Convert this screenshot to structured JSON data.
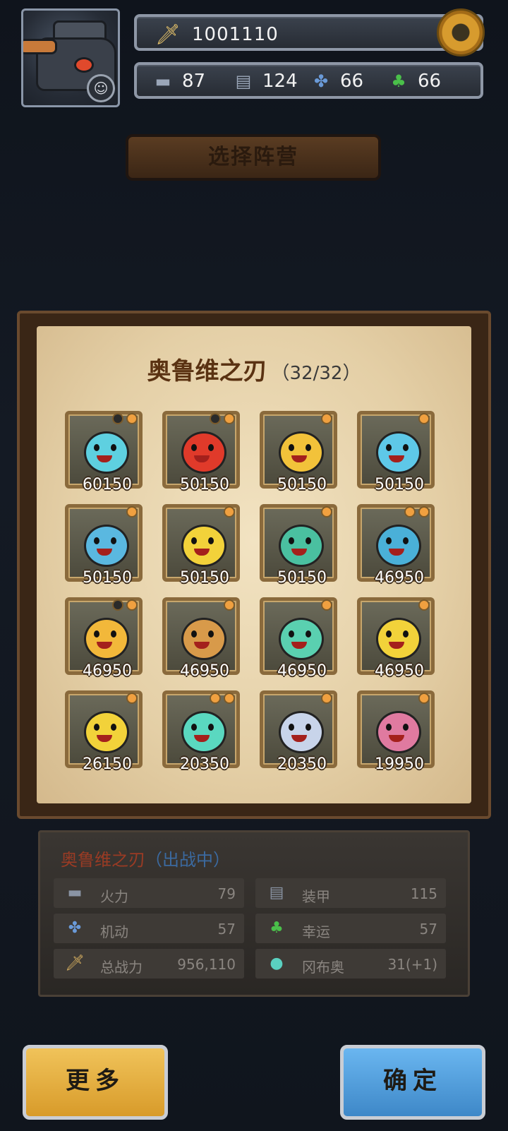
{
  "header": {
    "power_value": "1001110",
    "stats": [
      {
        "icon": "tank-gun-icon",
        "value": "87"
      },
      {
        "icon": "armor-icon",
        "value": "124"
      },
      {
        "icon": "propeller-icon",
        "value": "66"
      },
      {
        "icon": "clover-icon",
        "value": "66"
      }
    ]
  },
  "faction_button": "选择阵营",
  "panel": {
    "title": "奥鲁维之刃",
    "count": "（32/32）"
  },
  "heroes": [
    {
      "value": "60150",
      "color": "#5ed0e0",
      "dots": [
        "off",
        "on"
      ]
    },
    {
      "value": "50150",
      "color": "#e03a2a",
      "dots": [
        "off",
        "on"
      ]
    },
    {
      "value": "50150",
      "color": "#f2c23a",
      "dots": [
        "on"
      ]
    },
    {
      "value": "50150",
      "color": "#5ec8e8",
      "dots": [
        "on"
      ]
    },
    {
      "value": "50150",
      "color": "#5ab8e0",
      "dots": [
        "on"
      ]
    },
    {
      "value": "50150",
      "color": "#f2d23a",
      "dots": [
        "on"
      ]
    },
    {
      "value": "50150",
      "color": "#4ac0a0",
      "dots": [
        "on"
      ]
    },
    {
      "value": "46950",
      "color": "#4ab0d8",
      "dots": [
        "on",
        "on"
      ]
    },
    {
      "value": "46950",
      "color": "#f2b83a",
      "dots": [
        "off",
        "on"
      ]
    },
    {
      "value": "46950",
      "color": "#d89a4a",
      "dots": [
        "on"
      ]
    },
    {
      "value": "46950",
      "color": "#5ad0b0",
      "dots": [
        "on"
      ]
    },
    {
      "value": "46950",
      "color": "#f2d23a",
      "dots": [
        "on"
      ]
    },
    {
      "value": "26150",
      "color": "#f2d23a",
      "dots": [
        "on"
      ]
    },
    {
      "value": "20350",
      "color": "#5ad8c0",
      "dots": [
        "on",
        "on"
      ]
    },
    {
      "value": "20350",
      "color": "#c8d4ea",
      "dots": [
        "on"
      ]
    },
    {
      "value": "19950",
      "color": "#e07aa0",
      "dots": [
        "on"
      ]
    }
  ],
  "info": {
    "name": "奥鲁维之刃",
    "status": "（出战中）",
    "rows": [
      {
        "icon": "tank-gun-icon",
        "label": "火力",
        "value": "79"
      },
      {
        "icon": "armor-icon",
        "label": "装甲",
        "value": "115"
      },
      {
        "icon": "propeller-icon",
        "label": "机动",
        "value": "57"
      },
      {
        "icon": "clover-icon",
        "label": "幸运",
        "value": "57"
      },
      {
        "icon": "sword-icon",
        "label": "总战力",
        "value": "956,110"
      },
      {
        "icon": "blob-icon",
        "label": "冈布奥",
        "value": "31(+1)"
      }
    ]
  },
  "buttons": {
    "more": "更多",
    "confirm": "确定"
  }
}
